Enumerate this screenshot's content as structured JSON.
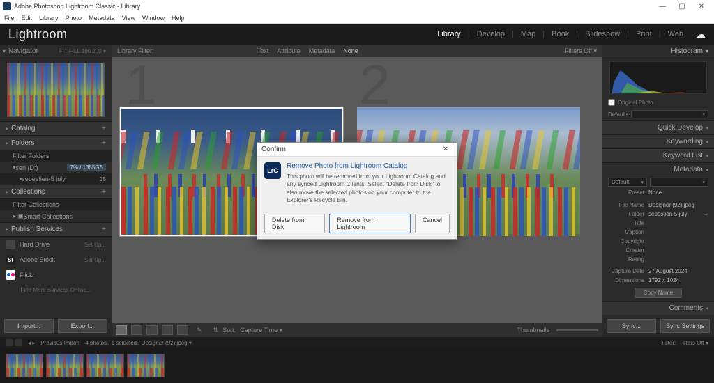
{
  "window": {
    "title": "Adobe Photoshop Lightroom Classic - Library",
    "controls": {
      "min": "—",
      "max": "▢",
      "close": "✕"
    }
  },
  "menubar": [
    "File",
    "Edit",
    "Library",
    "Photo",
    "Metadata",
    "View",
    "Window",
    "Help"
  ],
  "brand": "Lightroom",
  "modules": [
    "Library",
    "Develop",
    "Map",
    "Book",
    "Slideshow",
    "Print",
    "Web"
  ],
  "active_module": "Library",
  "left": {
    "navigator": {
      "title": "Navigator",
      "opts": "FIT    FILL    100    200  ▾"
    },
    "catalog": "Catalog",
    "folders": {
      "title": "Folders",
      "filter": "Filter Folders",
      "drive": "seri (D:)",
      "drive_badge": "7% / 1355GB",
      "folder": "sebestien-5 july",
      "count": "25"
    },
    "collections": {
      "title": "Collections",
      "filter": "Filter Collections",
      "smart": "Smart Collections"
    },
    "publish": {
      "title": "Publish Services",
      "hd": "Hard Drive",
      "stock": "Adobe Stock",
      "flickr": "Flickr",
      "setup": "Set Up...",
      "find": "Find More Services Online..."
    },
    "buttons": {
      "import": "Import...",
      "export": "Export..."
    }
  },
  "center": {
    "lib_filter": "Library Filter:",
    "filters": {
      "text": "Text",
      "attr": "Attribute",
      "meta": "Metadata",
      "none": "None"
    },
    "filters_off": "Filters Off ▾",
    "sort_label": "Sort:",
    "sort_value": "Capture Time ▾",
    "thumbnails_label": "Thumbnails"
  },
  "right": {
    "histogram": "Histogram",
    "original": "Original Photo",
    "defaults_label": "Defaults",
    "quick": "Quick Develop",
    "keywording": "Keywording",
    "keywordlist": "Keyword List",
    "metadata": {
      "title": "Metadata",
      "dd_left": "Default",
      "dd_right": "",
      "preset": "Preset",
      "preset_val": "None",
      "filename": "File Name",
      "filename_val": "Designer (92).jpeg",
      "folder": "Folder",
      "folder_val": "sebestien-5 july",
      "title_f": "Title",
      "caption": "Caption",
      "copyright": "Copyright",
      "creator": "Creator",
      "rating": "Rating",
      "capture": "Capture Date",
      "capture_val": "27 August 2024",
      "dim": "Dimensions",
      "dim_val": "1792 x 1024",
      "copyname_btn": "Copy Name"
    },
    "comments": "Comments",
    "btn_sync": "Sync...",
    "btn_sync_set": "Sync Settings"
  },
  "filmstrip": {
    "prev": "Previous Import",
    "count": "4 photos / 1 selected / Designer (92).jpeg  ▾",
    "filter": "Filter:",
    "filters_off": "Filters Off  ▾"
  },
  "dialog": {
    "title": "Confirm",
    "icon": "LrC",
    "heading": "Remove Photo from Lightroom Catalog",
    "text": "This photo will be removed from your Lightroom Catalog and any synced Lightroom Clients. Select \"Delete from Disk\" to also move the selected photos on your computer to the Explorer's Recycle Bin.",
    "btn_delete": "Delete from Disk",
    "btn_remove": "Remove from Lightroom",
    "btn_cancel": "Cancel"
  }
}
